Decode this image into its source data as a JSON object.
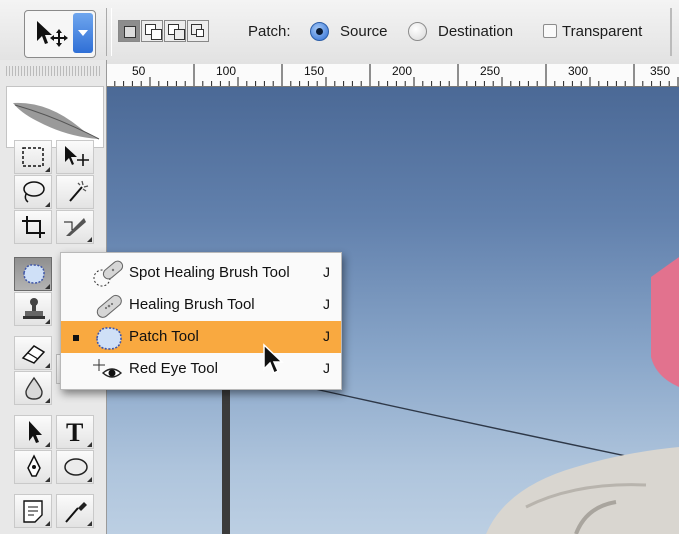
{
  "options_bar": {
    "patch_label": "Patch:",
    "source_label": "Source",
    "destination_label": "Destination",
    "transparent_label": "Transparent",
    "patch_mode": "Source",
    "transparent_checked": false,
    "selection_mode_selected": "new-selection"
  },
  "ruler": {
    "labels": [
      "50",
      "100",
      "150",
      "200",
      "250",
      "300",
      "350"
    ]
  },
  "tools": {
    "active_tool": "Patch Tool",
    "icons": [
      "marquee-icon",
      "move-icon",
      "lasso-icon",
      "magic-wand-icon",
      "crop-icon",
      "slice-icon",
      "patch-icon",
      "clone-stamp-icon",
      "eraser-icon",
      "blur-icon",
      "path-selection-icon",
      "type-icon",
      "pen-icon",
      "ellipse-icon",
      "notes-icon",
      "eyedropper-icon"
    ],
    "type_glyph": "T"
  },
  "flyout": {
    "items": [
      {
        "label": "Spot Healing Brush Tool",
        "shortcut": "J",
        "icon": "spot-healing-brush-icon",
        "selected": false
      },
      {
        "label": "Healing Brush Tool",
        "shortcut": "J",
        "icon": "healing-brush-icon",
        "selected": false
      },
      {
        "label": "Patch Tool",
        "shortcut": "J",
        "icon": "patch-icon",
        "selected": true
      },
      {
        "label": "Red Eye Tool",
        "shortcut": "J",
        "icon": "red-eye-icon",
        "selected": false
      }
    ]
  },
  "colors": {
    "highlight": "#f9a940",
    "radio_on": "#2b6bd3",
    "sky_top": "#4b6996",
    "sky_bottom": "#bccfe3"
  }
}
